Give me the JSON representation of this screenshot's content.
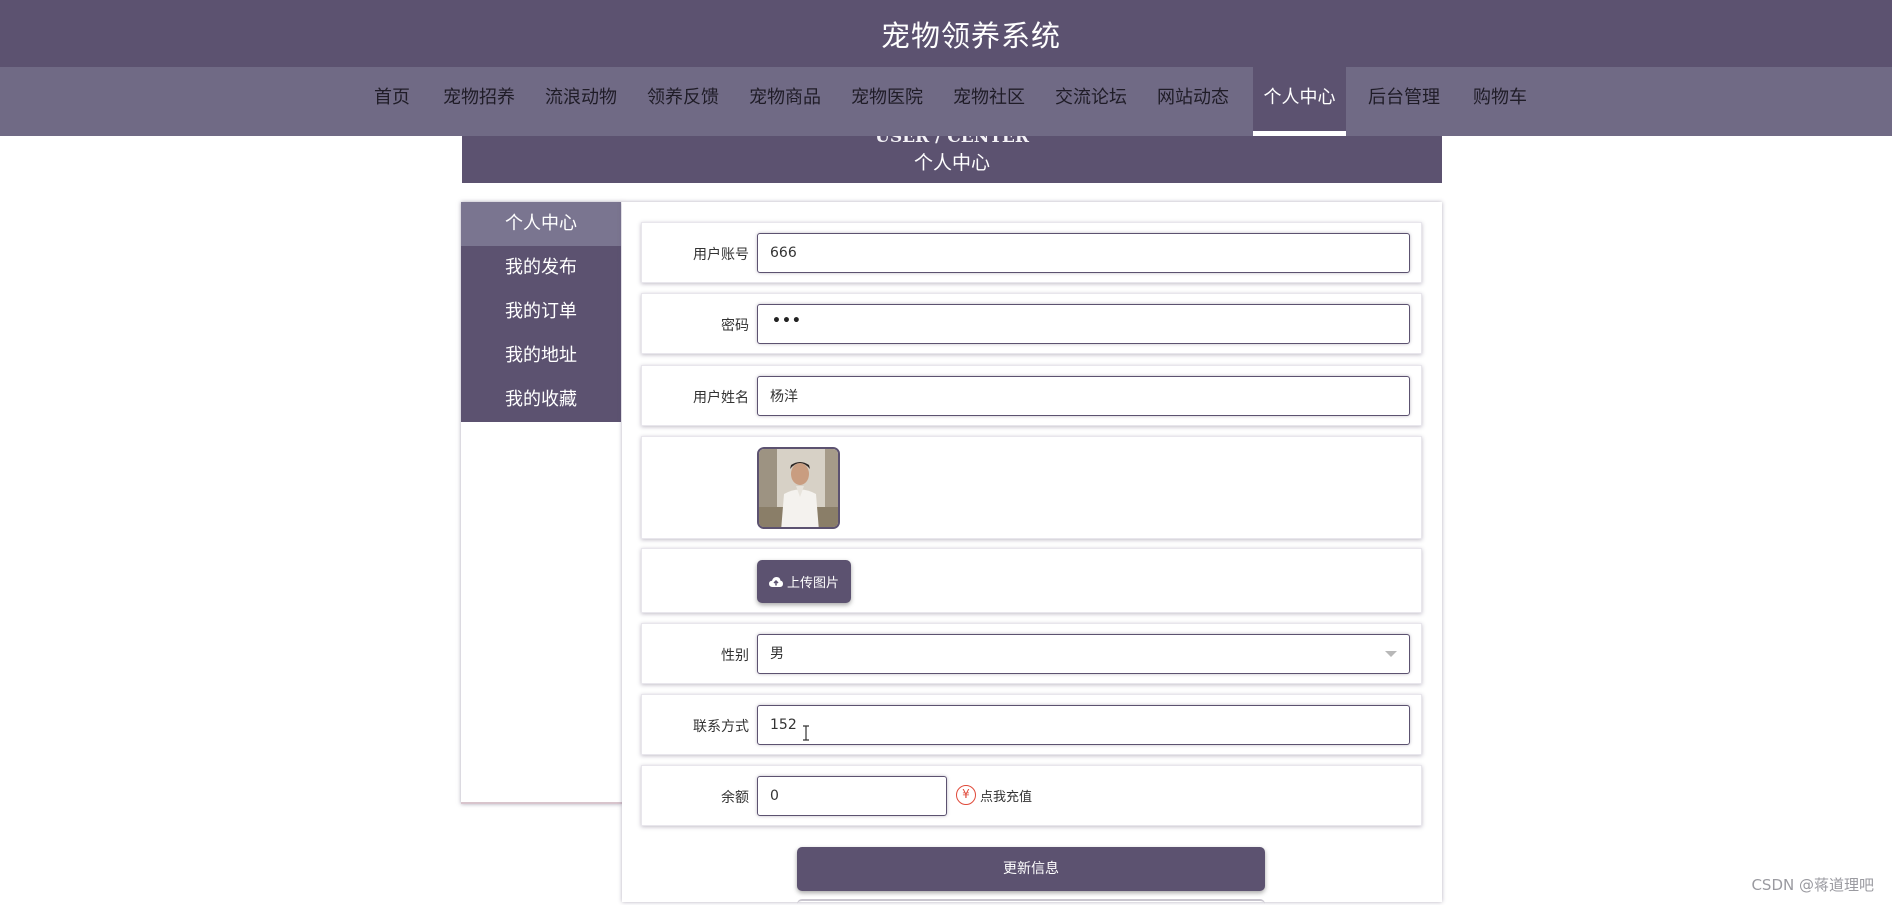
{
  "header": {
    "title": "宠物领养系统"
  },
  "nav": {
    "items": [
      "首页",
      "宠物招养",
      "流浪动物",
      "领养反馈",
      "宠物商品",
      "宠物医院",
      "宠物社区",
      "交流论坛",
      "网站动态",
      "个人中心",
      "后台管理",
      "购物车"
    ],
    "active_index": 9
  },
  "banner": {
    "subtitle_en": "USER / CENTER",
    "title": "个人中心"
  },
  "sidebar": {
    "items": [
      "个人中心",
      "我的发布",
      "我的订单",
      "我的地址",
      "我的收藏"
    ],
    "active_index": 0
  },
  "form": {
    "account": {
      "label": "用户账号",
      "value": "666"
    },
    "password": {
      "label": "密码",
      "dots": "•••"
    },
    "name": {
      "label": "用户姓名",
      "value": "杨洋"
    },
    "upload": {
      "label": "上传图片"
    },
    "gender": {
      "label": "性别",
      "value": "男"
    },
    "contact": {
      "label": "联系方式",
      "value": "152"
    },
    "balance": {
      "label": "余额",
      "value": "0"
    },
    "recharge": {
      "label": "点我充值",
      "icon": "¥"
    },
    "update_button": "更新信息"
  },
  "watermark": "CSDN @蒋道理吧",
  "colors": {
    "primary": "#5c5270",
    "nav_bg": "#706a85",
    "active_side": "#7a7590",
    "recharge_red": "#e04a3a"
  },
  "icons": {
    "upload": "cloud-upload-icon",
    "recharge": "yen-icon",
    "select": "chevron-down-icon"
  }
}
